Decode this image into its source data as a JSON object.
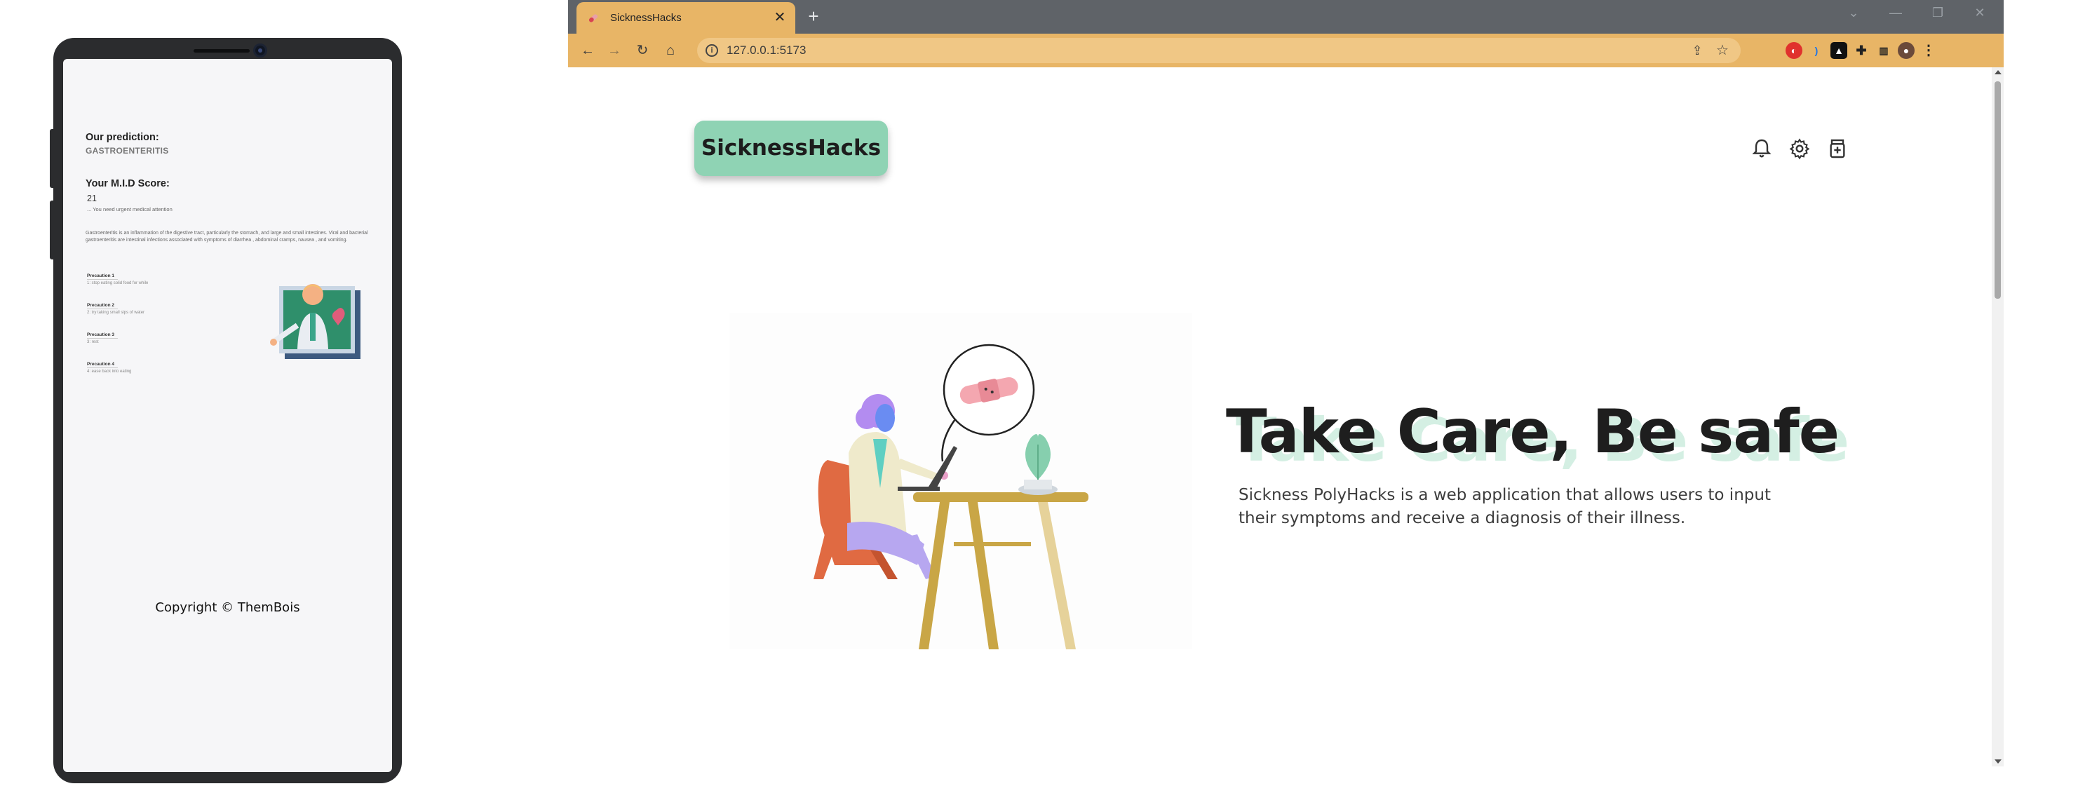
{
  "phone": {
    "prediction_label": "Our prediction:",
    "prediction_value": "GASTROENTERITIS",
    "score_label": "Your M.I.D Score:",
    "score_value": "21",
    "score_note": "... You need urgent medical attention",
    "description": "Gastroenteritis is an inflammation of the digestive tract, particularly the stomach, and large and small intestines. Viral and bacterial gastroenteritis are intestinal infections associated with symptoms of diarrhea , abdominal cramps, nausea , and vomiting.",
    "precautions": [
      {
        "title": "Precaution 1",
        "value": "1: stop eating solid food for while"
      },
      {
        "title": "Precaution 2",
        "value": "2: try taking small sips of water"
      },
      {
        "title": "Precaution 3",
        "value": "3: rest"
      },
      {
        "title": "Precaution 4",
        "value": "4: ease back into eating"
      }
    ],
    "copyright": "Copyright © ThemBois"
  },
  "browser": {
    "tab_title": "SicknessHacks",
    "url": "127.0.0.1:5173",
    "accent_color": "#e8b566"
  },
  "page": {
    "logo": "SicknessHacks",
    "logo_color": "#8fd3b4",
    "nav_icons": [
      "bell-icon",
      "gear-icon",
      "medicine-bottle-icon"
    ],
    "hero_title": "Take Care, Be safe",
    "hero_description": "Sickness PolyHacks is a web application that allows users to input their symptoms and receive a diagnosis of their illness."
  }
}
